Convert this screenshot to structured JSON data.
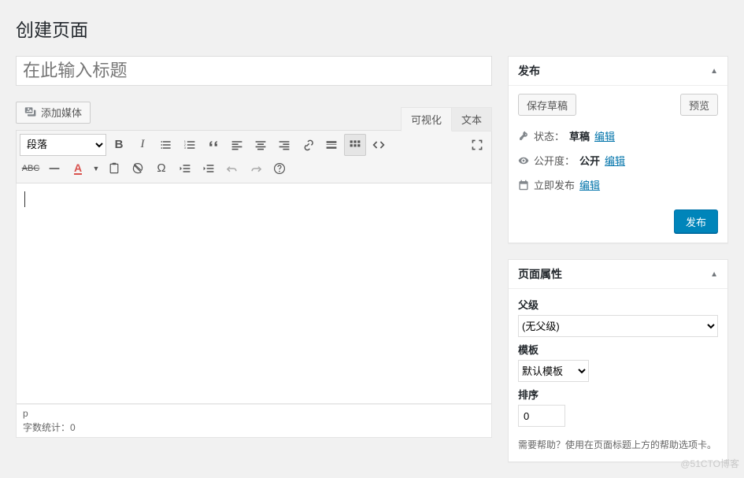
{
  "page_title": "创建页面",
  "title_input": {
    "placeholder": "在此输入标题",
    "value": ""
  },
  "media_button": "添加媒体",
  "editor_tabs": {
    "visual": "可视化",
    "text": "文本"
  },
  "format_select": "段落",
  "content_value": "",
  "status_path": "p",
  "word_count_label": "字数统计：",
  "word_count_value": 0,
  "publish_box": {
    "title": "发布",
    "save_draft": "保存草稿",
    "preview": "预览",
    "status_label": "状态：",
    "status_value": "草稿",
    "visibility_label": "公开度：",
    "visibility_value": "公开",
    "publish_label": "立即发布",
    "edit_link": "编辑",
    "publish_btn": "发布"
  },
  "attributes_box": {
    "title": "页面属性",
    "parent_label": "父级",
    "parent_value": "(无父级)",
    "template_label": "模板",
    "template_value": "默认模板",
    "order_label": "排序",
    "order_value": "0",
    "help_text": "需要帮助？使用在页面标题上方的帮助选项卡。"
  },
  "watermark": "@51CTO博客"
}
